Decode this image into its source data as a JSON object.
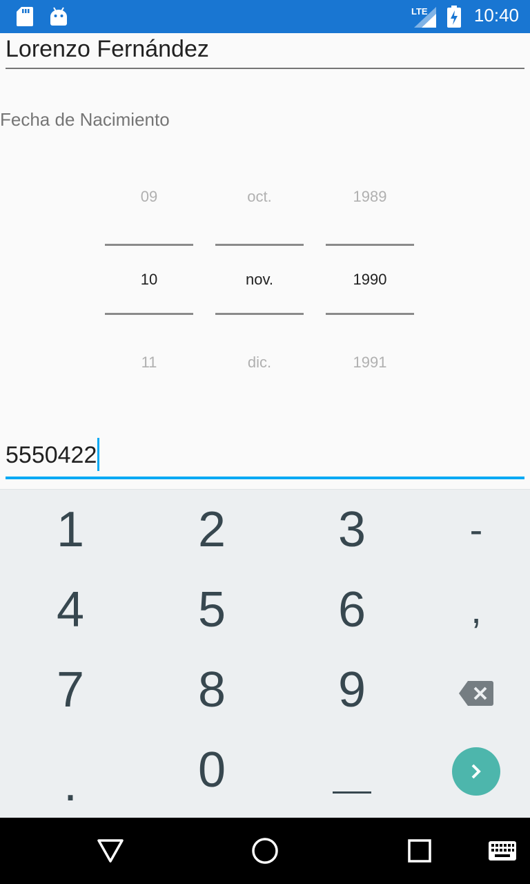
{
  "status_bar": {
    "time": "10:40",
    "network": "LTE",
    "icons": [
      "sd-card-icon",
      "android-icon",
      "signal-icon",
      "battery-charging-icon"
    ],
    "background": "#1976d2"
  },
  "form": {
    "name_value": "Lorenzo Fernández",
    "birthdate_label": "Fecha de Nacimiento",
    "phone_value": "5550422"
  },
  "date_picker": {
    "day": {
      "prev": "09",
      "current": "10",
      "next": "11"
    },
    "month": {
      "prev": "oct.",
      "current": "nov.",
      "next": "dic."
    },
    "year": {
      "prev": "1989",
      "current": "1990",
      "next": "1991"
    }
  },
  "keyboard": {
    "keys": {
      "k1": "1",
      "k2": "2",
      "k3": "3",
      "dash": "-",
      "k4": "4",
      "k5": "5",
      "k6": "6",
      "comma": ",",
      "k7": "7",
      "k8": "8",
      "k9": "9",
      "dot": ".",
      "k0": "0"
    },
    "accent": "#4db6ac"
  },
  "nav_bar": {
    "icons": [
      "back-icon",
      "home-icon",
      "recents-icon",
      "keyboard-icon"
    ]
  }
}
